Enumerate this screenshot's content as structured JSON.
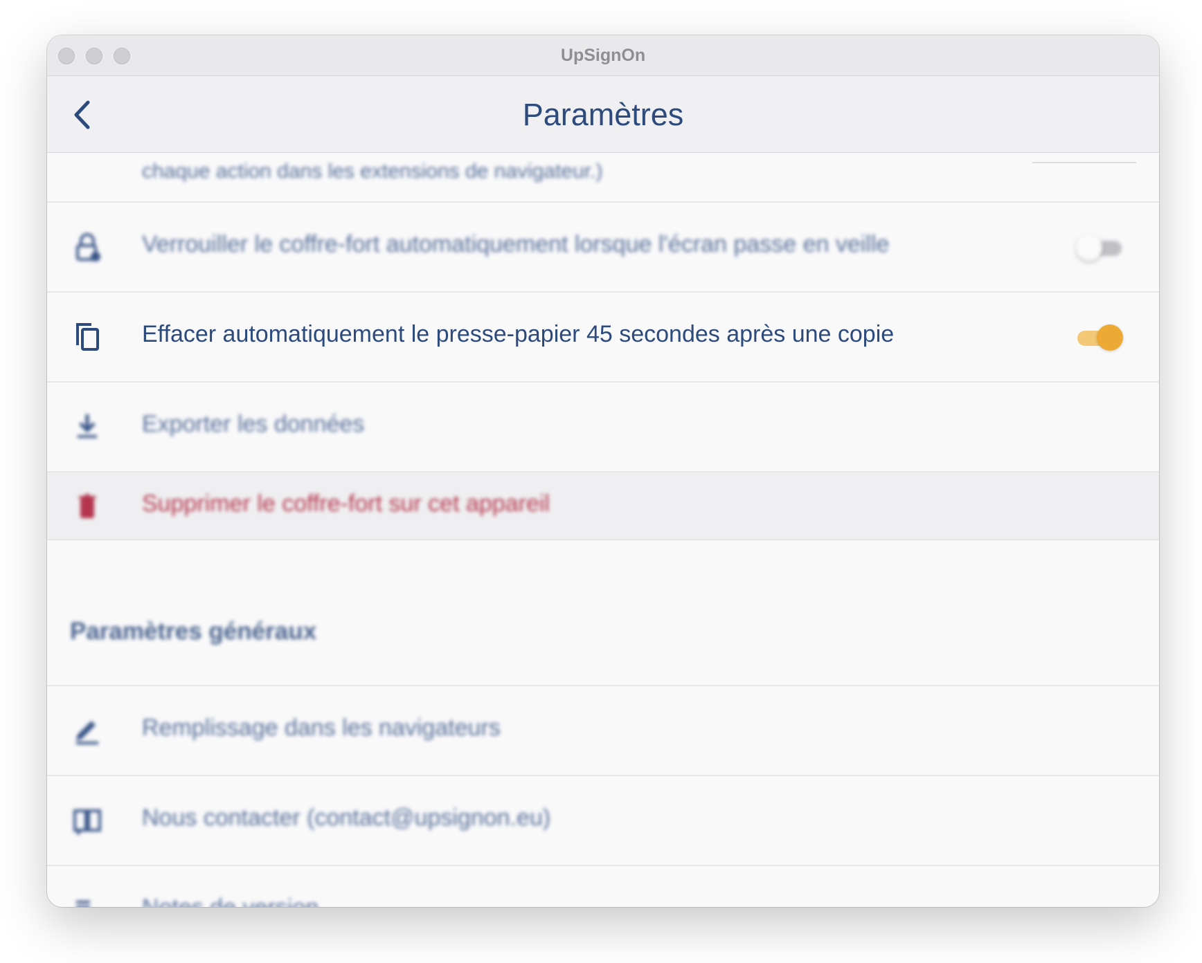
{
  "window": {
    "title": "UpSignOn"
  },
  "navbar": {
    "title": "Paramètres",
    "back_icon": "chevron-left-icon"
  },
  "colors": {
    "primary": "#2c4a7c",
    "toggle_on": "#ecaa35",
    "danger": "#b5354d"
  },
  "settings": {
    "top_partial_text": "chaque action dans les extensions de navigateur.)",
    "lock_on_sleep": {
      "icon": "lock-icon",
      "label": "Verrouiller le coffre-fort automatiquement lorsque l'écran passe en veille",
      "enabled": false
    },
    "clear_clipboard": {
      "icon": "copy-icon",
      "label": "Effacer automatiquement le presse-papier 45 secondes après une copie",
      "enabled": true
    },
    "export": {
      "icon": "download-icon",
      "label": "Exporter les données"
    },
    "delete_vault": {
      "icon": "trash-icon",
      "label": "Supprimer le coffre-fort sur cet appareil"
    }
  },
  "general": {
    "title": "Paramètres généraux",
    "items": [
      {
        "icon": "pen-icon",
        "label": "Remplissage dans les navigateurs"
      },
      {
        "icon": "book-icon",
        "label": "Nous contacter (contact@upsignon.eu)"
      },
      {
        "icon": "notes-icon",
        "label": "Notes de version"
      }
    ]
  }
}
